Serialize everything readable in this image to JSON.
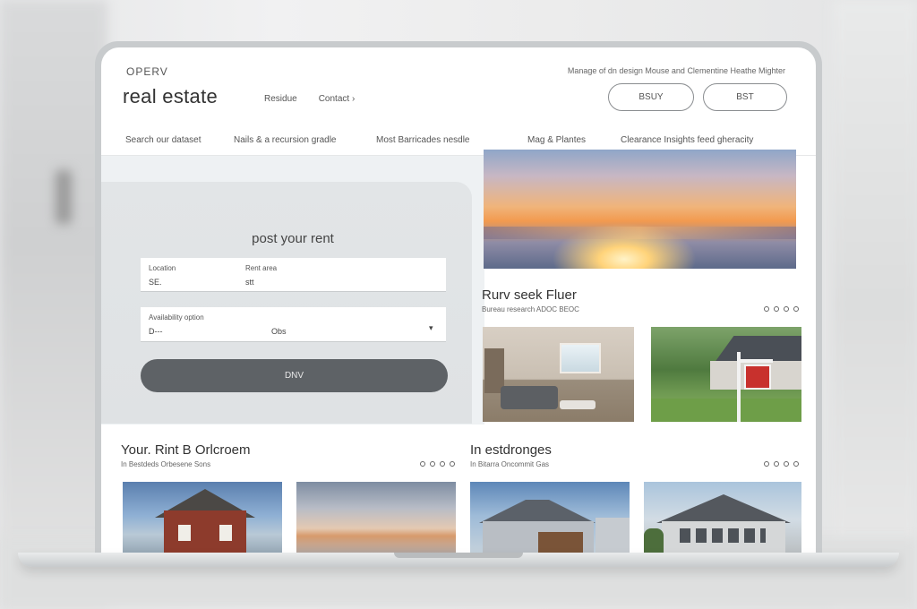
{
  "header": {
    "brand_top": "OPERV",
    "brand": "real estate",
    "nav": [
      "Residue",
      "Contact ›"
    ],
    "tagline": "Manage of dn design Mouse and Clementine Heathe Mighter",
    "buttons": [
      "BSUY",
      "BST"
    ]
  },
  "category_nav": [
    "Search our dataset",
    "Nails & a recursion gradle",
    "Most Barricades nesdle",
    "Mag & Plantes",
    "Clearance Insights feed gheracity"
  ],
  "form": {
    "title": "post your rent",
    "field1": {
      "label_a": "Location",
      "label_b": "Rent area",
      "value_a": "SE.",
      "value_b": "stt"
    },
    "field2": {
      "label": "Availability option",
      "value_a": "D---",
      "value_b": "Obs",
      "chevron": "▾"
    },
    "submit_label": "DNV"
  },
  "section_right": {
    "title": "Rurv seek Fluer",
    "subtitle": "Bureau research ADOC   BEOC"
  },
  "section_bottom_left": {
    "title": "Your. Rint B Orlcroem",
    "subtitle": "In Bestdeds Orbesene   Sons"
  },
  "section_bottom_right": {
    "title": "In estdronges",
    "subtitle": "In Bitarra Oncommit   Gas"
  },
  "icons": {
    "carousel": "carousel-dots-icon",
    "dropdown": "chevron-down-icon"
  },
  "colors": {
    "button_dark": "#5e6266",
    "panel": "#e2e5e7",
    "sign_red": "#c8312d"
  }
}
